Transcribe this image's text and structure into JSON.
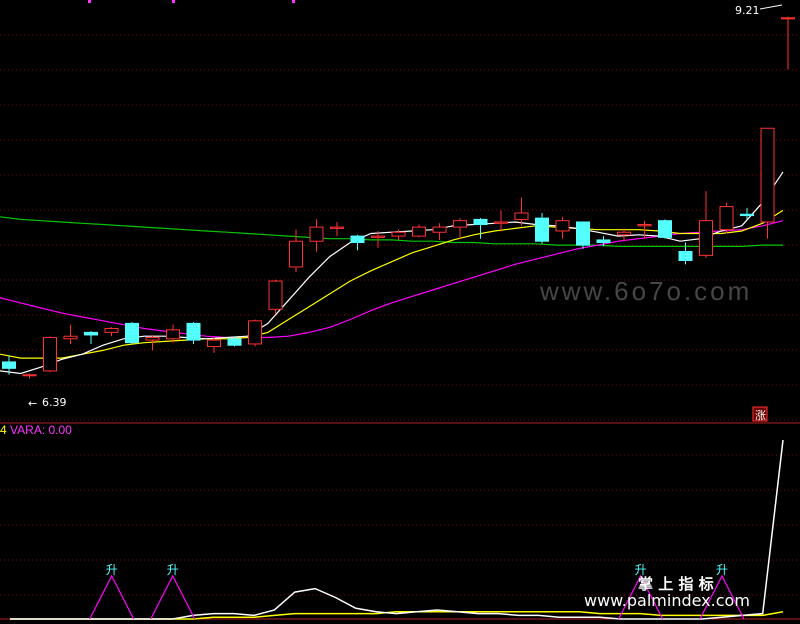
{
  "price_pane": {
    "high_marker": "9.21",
    "low_marker": "6.39",
    "limit_up_badge": "涨"
  },
  "indicator_pane": {
    "prefix": "4",
    "label": "VARA: 0.00",
    "signal_text": "升"
  },
  "watermarks": {
    "site1": "www.6o7o.com",
    "brand_cn": "掌 上 指 标",
    "site2": "www.palmindex.com"
  },
  "colors": {
    "up": "#ff3232",
    "down": "#54ffff",
    "ma5": "#ffffff",
    "ma10": "#ffff00",
    "ma20": "#ff00ff",
    "ma60": "#00c800",
    "grid": "#8b0000"
  },
  "chart_data": {
    "type": "candlestick",
    "y_range": [
      6.2,
      9.3
    ],
    "candles": [
      {
        "o": 6.52,
        "c": 6.47,
        "h": 6.57,
        "l": 6.42
      },
      {
        "o": 6.42,
        "c": 6.42,
        "h": 6.43,
        "l": 6.39
      },
      {
        "o": 6.45,
        "c": 6.71,
        "h": 6.72,
        "l": 6.44
      },
      {
        "o": 6.7,
        "c": 6.72,
        "h": 6.81,
        "l": 6.66
      },
      {
        "o": 6.75,
        "c": 6.73,
        "h": 6.76,
        "l": 6.66
      },
      {
        "o": 6.75,
        "c": 6.78,
        "h": 6.79,
        "l": 6.72
      },
      {
        "o": 6.82,
        "c": 6.67,
        "h": 6.83,
        "l": 6.66
      },
      {
        "o": 6.69,
        "c": 6.71,
        "h": 6.73,
        "l": 6.61
      },
      {
        "o": 6.7,
        "c": 6.77,
        "h": 6.81,
        "l": 6.67
      },
      {
        "o": 6.82,
        "c": 6.69,
        "h": 6.83,
        "l": 6.66
      },
      {
        "o": 6.64,
        "c": 6.69,
        "h": 6.71,
        "l": 6.59
      },
      {
        "o": 6.7,
        "c": 6.65,
        "h": 6.72,
        "l": 6.64
      },
      {
        "o": 6.66,
        "c": 6.84,
        "h": 6.85,
        "l": 6.64
      },
      {
        "o": 6.93,
        "c": 7.15,
        "h": 7.16,
        "l": 6.89
      },
      {
        "o": 7.26,
        "c": 7.46,
        "h": 7.55,
        "l": 7.22
      },
      {
        "o": 7.46,
        "c": 7.57,
        "h": 7.63,
        "l": 7.38
      },
      {
        "o": 7.56,
        "c": 7.57,
        "h": 7.61,
        "l": 7.5
      },
      {
        "o": 7.5,
        "c": 7.45,
        "h": 7.51,
        "l": 7.39
      },
      {
        "o": 7.49,
        "c": 7.5,
        "h": 7.54,
        "l": 7.41
      },
      {
        "o": 7.5,
        "c": 7.53,
        "h": 7.55,
        "l": 7.47
      },
      {
        "o": 7.5,
        "c": 7.57,
        "h": 7.59,
        "l": 7.49
      },
      {
        "o": 7.53,
        "c": 7.57,
        "h": 7.6,
        "l": 7.47
      },
      {
        "o": 7.57,
        "c": 7.62,
        "h": 7.64,
        "l": 7.48
      },
      {
        "o": 7.63,
        "c": 7.59,
        "h": 7.64,
        "l": 7.48
      },
      {
        "o": 7.6,
        "c": 7.61,
        "h": 7.7,
        "l": 7.54
      },
      {
        "o": 7.63,
        "c": 7.68,
        "h": 7.8,
        "l": 7.58
      },
      {
        "o": 7.64,
        "c": 7.46,
        "h": 7.68,
        "l": 7.44
      },
      {
        "o": 7.54,
        "c": 7.62,
        "h": 7.65,
        "l": 7.48
      },
      {
        "o": 7.61,
        "c": 7.43,
        "h": 7.61,
        "l": 7.4
      },
      {
        "o": 7.47,
        "c": 7.45,
        "h": 7.5,
        "l": 7.42
      },
      {
        "o": 7.51,
        "c": 7.53,
        "h": 7.56,
        "l": 7.46
      },
      {
        "o": 7.58,
        "c": 7.59,
        "h": 7.62,
        "l": 7.48
      },
      {
        "o": 7.62,
        "c": 7.49,
        "h": 7.63,
        "l": 7.48
      },
      {
        "o": 7.38,
        "c": 7.31,
        "h": 7.45,
        "l": 7.28
      },
      {
        "o": 7.35,
        "c": 7.62,
        "h": 7.85,
        "l": 7.33
      },
      {
        "o": 7.55,
        "c": 7.73,
        "h": 7.76,
        "l": 7.52
      },
      {
        "o": 7.67,
        "c": 7.66,
        "h": 7.72,
        "l": 7.63
      },
      {
        "o": 7.61,
        "c": 8.34,
        "h": 8.34,
        "l": 7.48
      },
      {
        "o": 9.2,
        "c": 9.2,
        "h": 9.21,
        "l": 8.8
      }
    ],
    "ma5": [
      6.45,
      6.43,
      6.48,
      6.54,
      6.58,
      6.65,
      6.7,
      6.72,
      6.72,
      6.71,
      6.7,
      6.71,
      6.72,
      6.82,
      7.0,
      7.18,
      7.34,
      7.45,
      7.52,
      7.53,
      7.54,
      7.55,
      7.58,
      7.59,
      7.6,
      7.61,
      7.59,
      7.58,
      7.56,
      7.53,
      7.5,
      7.51,
      7.5,
      7.46,
      7.48,
      7.54,
      7.58,
      7.76,
      8.0
    ],
    "ma10": [
      6.58,
      6.55,
      6.55,
      6.55,
      6.58,
      6.61,
      6.65,
      6.67,
      6.68,
      6.69,
      6.7,
      6.7,
      6.71,
      6.75,
      6.85,
      6.95,
      7.05,
      7.15,
      7.23,
      7.3,
      7.37,
      7.42,
      7.47,
      7.51,
      7.54,
      7.56,
      7.58,
      7.57,
      7.56,
      7.55,
      7.55,
      7.55,
      7.54,
      7.52,
      7.52,
      7.52,
      7.54,
      7.6,
      7.7
    ],
    "ma20": [
      7.02,
      6.98,
      6.94,
      6.9,
      6.87,
      6.84,
      6.81,
      6.78,
      6.76,
      6.74,
      6.72,
      6.71,
      6.71,
      6.71,
      6.72,
      6.75,
      6.79,
      6.85,
      6.92,
      6.98,
      7.03,
      7.08,
      7.13,
      7.18,
      7.23,
      7.28,
      7.32,
      7.36,
      7.4,
      7.43,
      7.46,
      7.48,
      7.5,
      7.52,
      7.53,
      7.54,
      7.55,
      7.58,
      7.62
    ],
    "ma60": [
      7.65,
      7.63,
      7.62,
      7.61,
      7.6,
      7.59,
      7.58,
      7.57,
      7.56,
      7.55,
      7.54,
      7.53,
      7.52,
      7.51,
      7.5,
      7.49,
      7.48,
      7.48,
      7.47,
      7.47,
      7.46,
      7.46,
      7.45,
      7.45,
      7.44,
      7.44,
      7.44,
      7.43,
      7.43,
      7.43,
      7.42,
      7.42,
      7.42,
      7.42,
      7.42,
      7.42,
      7.42,
      7.43,
      7.43
    ],
    "indicator": {
      "range": [
        0,
        1
      ],
      "white": [
        0,
        0,
        0,
        0,
        0,
        0,
        0,
        0,
        0,
        0.02,
        0.03,
        0.03,
        0.02,
        0.05,
        0.15,
        0.17,
        0.12,
        0.06,
        0.04,
        0.03,
        0.04,
        0.05,
        0.04,
        0.03,
        0.03,
        0.02,
        0.02,
        0.01,
        0.01,
        0.01,
        0,
        0,
        0,
        0,
        0,
        0.01,
        0.02,
        0.03,
        1.0
      ],
      "yellow": [
        0,
        0,
        0,
        0,
        0,
        0,
        0,
        0,
        0,
        0,
        0.01,
        0.01,
        0.01,
        0.02,
        0.03,
        0.03,
        0.03,
        0.03,
        0.03,
        0.04,
        0.04,
        0.04,
        0.04,
        0.04,
        0.04,
        0.04,
        0.04,
        0.04,
        0.04,
        0.03,
        0.03,
        0.03,
        0.02,
        0.02,
        0.02,
        0.02,
        0.02,
        0.02,
        0.04
      ],
      "signals": [
        5,
        8,
        31,
        35
      ]
    }
  }
}
